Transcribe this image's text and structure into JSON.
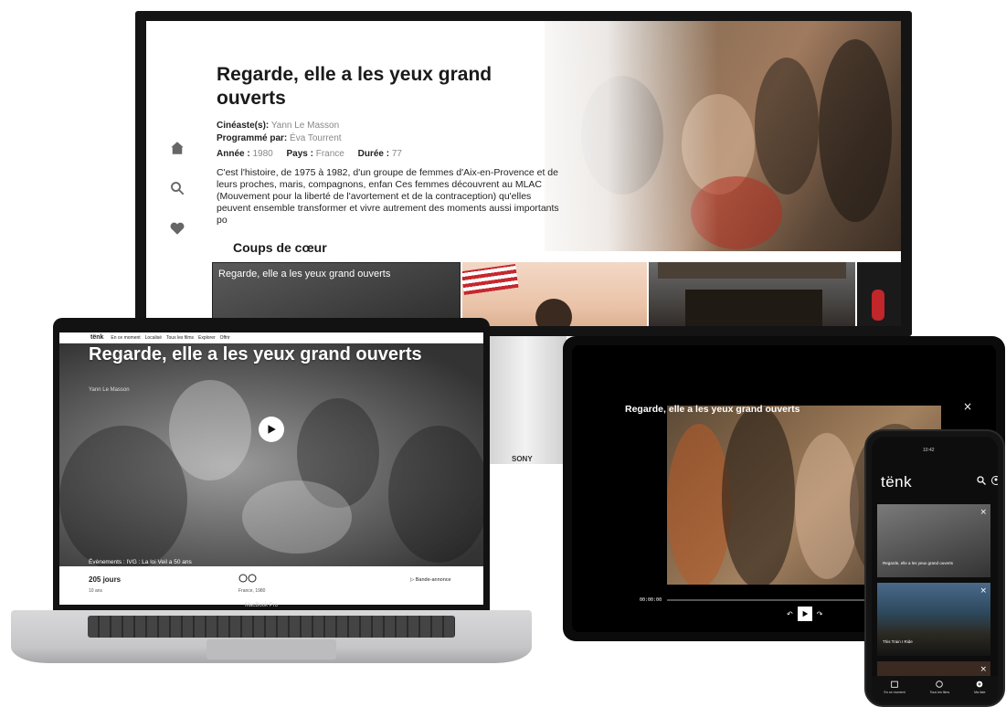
{
  "tv": {
    "title": "Regarde, elle a les yeux grand ouverts",
    "meta": {
      "cineaste_label": "Cinéaste(s):",
      "cineaste": "Yann Le Masson",
      "programme_label": "Programmé par:",
      "programme": "Éva Tourrent",
      "annee_label": "Année :",
      "annee": "1980",
      "pays_label": "Pays :",
      "pays": "France",
      "duree_label": "Durée :",
      "duree": "77"
    },
    "description": "C'est l'histoire, de 1975 à 1982, d'un groupe de femmes d'Aix-en-Provence et de leurs proches, maris, compagnons, enfan Ces femmes découvrent au MLAC (Mouvement pour la liberté de l'avortement et de la contraception) qu'elles peuvent ensemble transformer et vivre autrement des moments aussi importants po",
    "section_title": "Coups de cœur",
    "row_cards": [
      {
        "label": "Regarde, elle a les yeux grand ouverts"
      },
      {
        "label": ""
      },
      {
        "label": ""
      },
      {
        "label": ""
      }
    ],
    "brand": "SONY"
  },
  "laptop": {
    "nav": {
      "logo": "tënk",
      "items": [
        "En ce moment",
        "Localisé",
        "Tous les films",
        "Explorer",
        "Offrir"
      ]
    },
    "title": "Regarde, elle a les yeux grand ouverts",
    "director": "Yann Le Masson",
    "event": "Évènements : IVG : La loi Veil a 50 ans",
    "days": "205 jours",
    "age": "10 ans",
    "country_year": "France, 1980",
    "trailer": "Bande-annonce",
    "brand": "MacBook Pro"
  },
  "tablet": {
    "title": "Regarde, elle a les yeux grand ouverts",
    "close": "×",
    "time": "00:00:00",
    "progress": 0.0
  },
  "phone": {
    "status_time": "10:42",
    "logo": "tënk",
    "cards": [
      {
        "label": "Regarde, elle a les yeux grand ouverts"
      },
      {
        "label": "This Train I Ride"
      },
      {
        "label": ""
      }
    ],
    "tabs": [
      {
        "label": "En ce moment"
      },
      {
        "label": "Tous les films"
      },
      {
        "label": "Ma liste"
      }
    ]
  },
  "colors": {
    "white": "#ffffff",
    "dark": "#141414",
    "text": "#1a1a1a",
    "muted": "#888888"
  }
}
